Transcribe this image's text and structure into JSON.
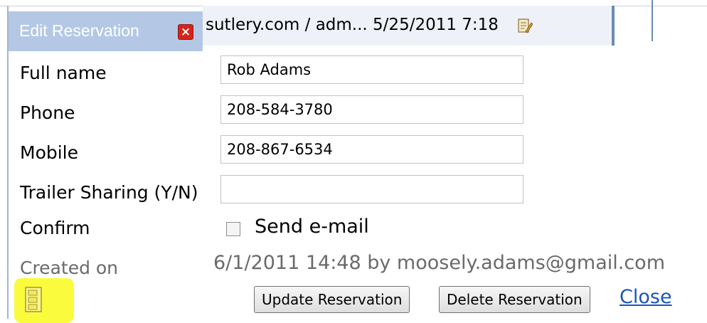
{
  "background": {
    "strip_text": "sutlery.com / adm...  5/25/2011 7:18",
    "edit_icon": "edit-note-icon"
  },
  "dialog": {
    "title": "Edit Reservation",
    "close_icon": "close-icon",
    "fields": [
      {
        "label": "Full name",
        "value": "Rob Adams"
      },
      {
        "label": "Phone",
        "value": "208-584-3780"
      },
      {
        "label": "Mobile",
        "value": "208-867-6534"
      },
      {
        "label": "Trailer Sharing (Y/N)",
        "value": ""
      }
    ],
    "confirm": {
      "label": "Confirm",
      "checkbox_label": "Send e-mail",
      "checked": false
    },
    "created": {
      "label": "Created on",
      "value": "6/1/2011 14:48 by moosely.adams@gmail.com"
    },
    "buttons": {
      "update": "Update Reservation",
      "delete": "Delete Reservation",
      "close": "Close"
    },
    "note_icon": "notes-icon",
    "colors": {
      "titlebar": "#b4c8e5",
      "highlight": "#fbfb3e",
      "link": "#1a56b8"
    }
  }
}
